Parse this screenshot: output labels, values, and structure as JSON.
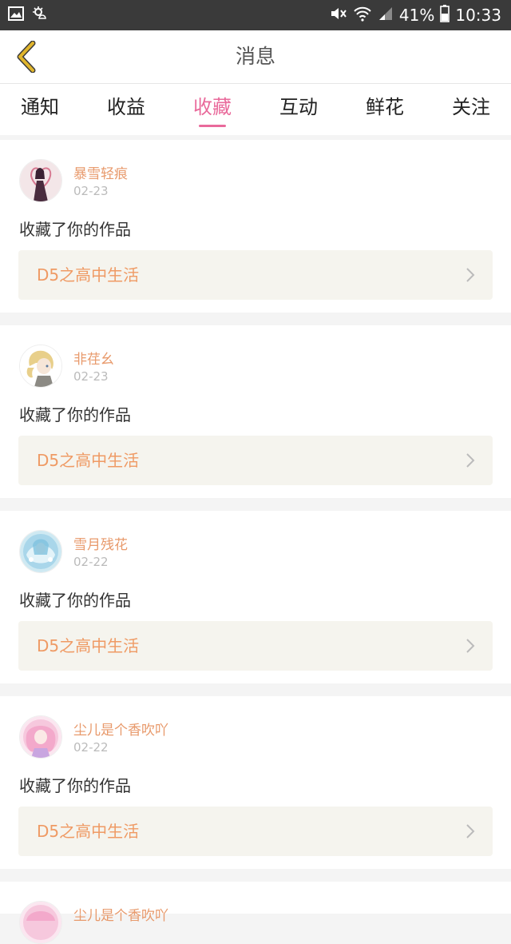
{
  "status_bar": {
    "battery": "41%",
    "time": "10:33",
    "icons": [
      "image-icon",
      "weather-icon",
      "mute-icon",
      "wifi-icon",
      "signal-icon",
      "battery-icon"
    ]
  },
  "header": {
    "title": "消息"
  },
  "tabs": [
    {
      "label": "通知",
      "active": false
    },
    {
      "label": "收益",
      "active": false
    },
    {
      "label": "收藏",
      "active": true
    },
    {
      "label": "互动",
      "active": false
    },
    {
      "label": "鲜花",
      "active": false
    },
    {
      "label": "关注",
      "active": false
    }
  ],
  "items": [
    {
      "user": "暴雪轻痕",
      "date": "02-23",
      "action": "收藏了你的作品",
      "work": "D5之高中生活"
    },
    {
      "user": "非荏幺",
      "date": "02-23",
      "action": "收藏了你的作品",
      "work": "D5之高中生活"
    },
    {
      "user": "雪月残花",
      "date": "02-22",
      "action": "收藏了你的作品",
      "work": "D5之高中生活"
    },
    {
      "user": "尘儿是个香吹吖",
      "date": "02-22",
      "action": "收藏了你的作品",
      "work": "D5之高中生活"
    },
    {
      "user": "尘儿是个香吹吖"
    }
  ],
  "colors": {
    "accent": "#e96a9b",
    "username": "#e89a6c",
    "work_title": "#ef9a64",
    "back_arrow": "#e0b52c",
    "status_bar_bg": "#3a3a3a"
  }
}
